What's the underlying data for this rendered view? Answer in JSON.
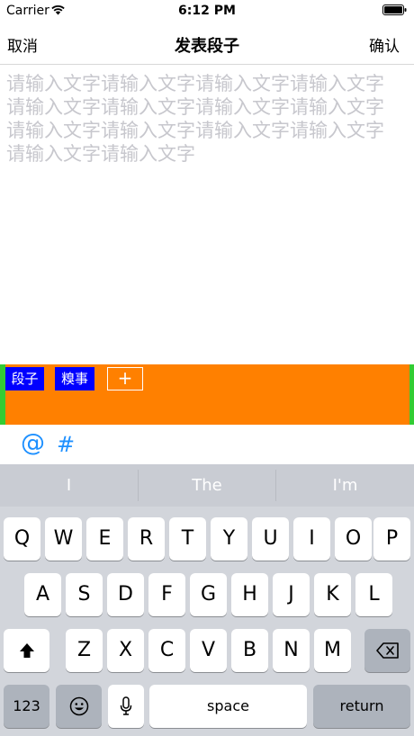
{
  "status_bar": {
    "carrier": "Carrier",
    "time": "6:12 PM"
  },
  "nav": {
    "cancel": "取消",
    "title": "发表段子",
    "confirm": "确认"
  },
  "editor": {
    "placeholder": "请输入文字请输入文字请输入文字请输入文字请输入文字请输入文字请输入文字请输入文字请输入文字请输入文字请输入文字请输入文字请输入文字请输入文字"
  },
  "tags": {
    "items": [
      "段子",
      "糗事"
    ],
    "add": "+"
  },
  "tools": {
    "mention": "@",
    "topic": "#"
  },
  "keyboard": {
    "suggestions": [
      "I",
      "The",
      "I'm"
    ],
    "row1": [
      "Q",
      "W",
      "E",
      "R",
      "T",
      "Y",
      "U",
      "I",
      "O",
      "P"
    ],
    "row2": [
      "A",
      "S",
      "D",
      "F",
      "G",
      "H",
      "J",
      "K",
      "L"
    ],
    "row3": [
      "Z",
      "X",
      "C",
      "V",
      "B",
      "N",
      "M"
    ],
    "numbers": "123",
    "space": "space",
    "return": "return"
  }
}
